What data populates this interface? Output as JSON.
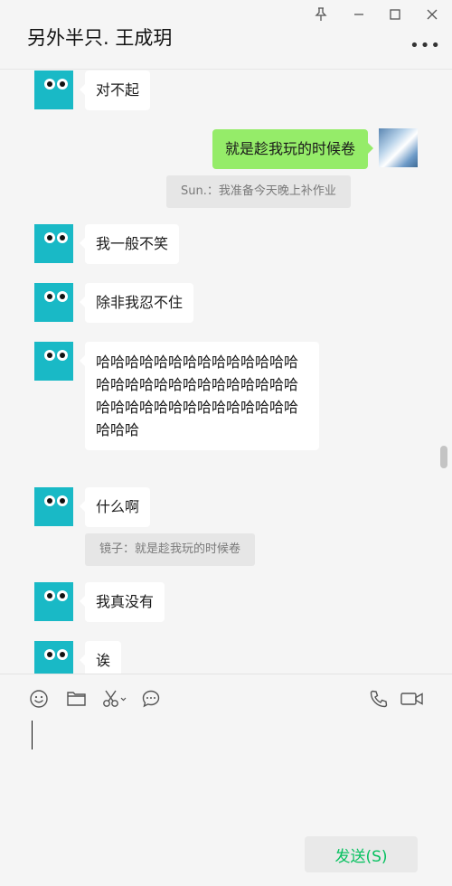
{
  "header": {
    "title": "另外半只. 王成玥"
  },
  "messages": {
    "m1": "对不起",
    "m2": "就是趁我玩的时候卷",
    "m3": "我一般不笑",
    "m4": "除非我忍不住",
    "m5": "哈哈哈哈哈哈哈哈哈哈哈哈哈哈哈哈哈哈哈哈哈哈哈哈哈哈哈哈哈哈哈哈哈哈哈哈哈哈哈哈哈哈哈哈哈",
    "m6": "什么啊",
    "m7": "我真没有",
    "m8": "诶"
  },
  "quotes": {
    "q1": "Sun.：我准备今天晚上补作业",
    "q2": "镜子：就是趁我玩的时候卷"
  },
  "composer": {
    "send_label": "发送(S)"
  },
  "colors": {
    "accent": "#07c160",
    "my_bubble": "#95ec69",
    "avatar": "#19b9c6"
  }
}
